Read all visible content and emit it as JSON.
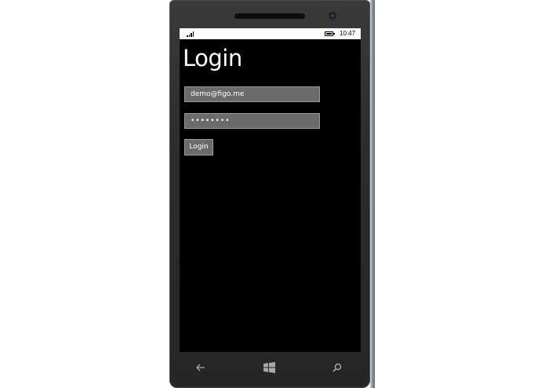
{
  "status_bar": {
    "time": "10:47",
    "icons": [
      "signal-strength-icon",
      "battery-icon"
    ]
  },
  "page": {
    "title": "Login"
  },
  "form": {
    "email_value": "demo@figo.me",
    "password_value": "••••••••",
    "login_label": "Login"
  },
  "nav_bar": {
    "icons": [
      "back-arrow-icon",
      "windows-start-icon",
      "search-icon"
    ]
  },
  "colors": {
    "screen_background": "#000000",
    "field_background": "#6b6b6b",
    "field_border": "#9a9a9a",
    "text": "#ffffff",
    "phone_bezel": "#2c2c2c"
  }
}
